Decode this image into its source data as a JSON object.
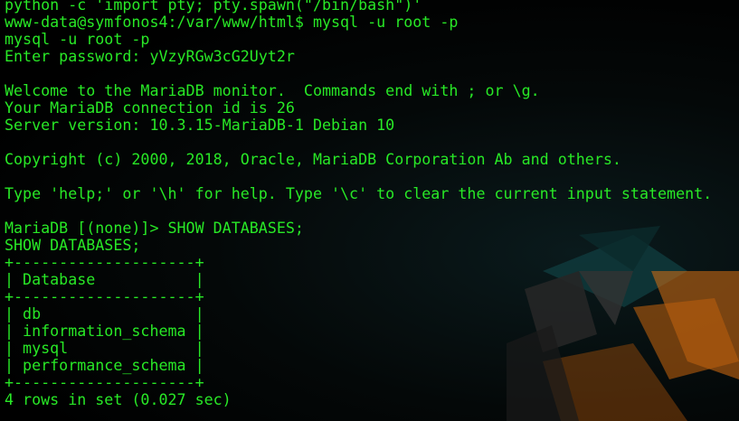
{
  "terminal": {
    "lines": [
      "python -c 'import pty; pty.spawn(\"/bin/bash\")'",
      "www-data@symfonos4:/var/www/html$ mysql -u root -p",
      "mysql -u root -p",
      "Enter password: yVzyRGw3cG2Uyt2r",
      "",
      "Welcome to the MariaDB monitor.  Commands end with ; or \\g.",
      "Your MariaDB connection id is 26",
      "Server version: 10.3.15-MariaDB-1 Debian 10",
      "",
      "Copyright (c) 2000, 2018, Oracle, MariaDB Corporation Ab and others.",
      "",
      "Type 'help;' or '\\h' for help. Type '\\c' to clear the current input statement.",
      "",
      "MariaDB [(none)]> SHOW DATABASES;",
      "SHOW DATABASES;",
      "+--------------------+",
      "| Database           |",
      "+--------------------+",
      "| db                 |",
      "| information_schema |",
      "| mysql              |",
      "| performance_schema |",
      "+--------------------+",
      "4 rows in set (0.027 sec)"
    ]
  },
  "colors": {
    "text": "#28e826",
    "background": "#000000",
    "art_orange": "#d96f12",
    "art_teal": "#0f3a3c",
    "art_grey": "#2a2a2a"
  }
}
